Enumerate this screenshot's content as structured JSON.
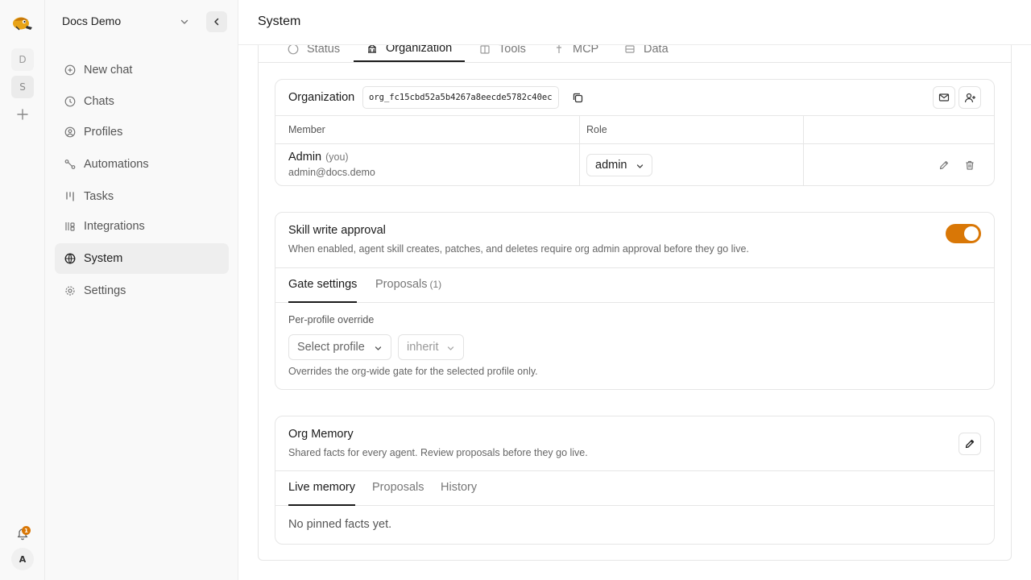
{
  "colors": {
    "accent": "#d97706",
    "sidebar_bg": "#f9f9f9",
    "border": "#e6e6e6"
  },
  "rail": {
    "workspaces": [
      "D",
      "S"
    ],
    "notification_count": "1",
    "avatar_initial": "A"
  },
  "sidebar": {
    "workspace_name": "Docs Demo",
    "items": [
      {
        "label": "New chat",
        "icon": "plus-circle-icon"
      },
      {
        "label": "Chats",
        "icon": "clock-icon"
      },
      {
        "label": "Profiles",
        "icon": "user-circle-icon"
      },
      {
        "label": "Automations",
        "icon": "workflow-icon"
      },
      {
        "label": "Tasks",
        "icon": "kanban-icon"
      },
      {
        "label": "Integrations",
        "icon": "plug-icon"
      },
      {
        "label": "System",
        "icon": "globe-icon",
        "active": true
      },
      {
        "label": "Settings",
        "icon": "gear-icon"
      }
    ]
  },
  "header": {
    "title": "System"
  },
  "tabs": [
    {
      "label": "Status"
    },
    {
      "label": "Organization",
      "active": true
    },
    {
      "label": "Tools"
    },
    {
      "label": "MCP"
    },
    {
      "label": "Data"
    }
  ],
  "organization": {
    "label": "Organization",
    "org_id": "org_fc15cbd52a5b4267a8eecde5782c40ec",
    "columns": [
      "Member",
      "Role",
      ""
    ],
    "members": [
      {
        "name": "Admin",
        "you": "(you)",
        "email": "admin@docs.demo",
        "role": "admin"
      }
    ]
  },
  "skill_approval": {
    "title": "Skill write approval",
    "description": "When enabled, agent skill creates, patches, and deletes require org admin approval before they go live.",
    "enabled": true,
    "subtabs": [
      {
        "label": "Gate settings",
        "active": true
      },
      {
        "label": "Proposals",
        "count": "(1)"
      }
    ],
    "override_label": "Per-profile override",
    "profile_select": "Select profile",
    "mode_select": "inherit",
    "note": "Overrides the org-wide gate for the selected profile only."
  },
  "org_memory": {
    "title": "Org Memory",
    "description": "Shared facts for every agent. Review proposals before they go live.",
    "subtabs": [
      {
        "label": "Live memory",
        "active": true
      },
      {
        "label": "Proposals"
      },
      {
        "label": "History"
      }
    ],
    "empty_text": "No pinned facts yet."
  }
}
